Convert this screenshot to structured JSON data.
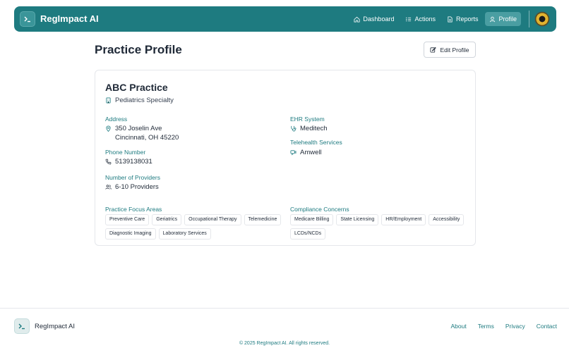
{
  "header": {
    "brand": "RegImpact AI",
    "nav": [
      {
        "label": "Dashboard",
        "icon": "home-icon"
      },
      {
        "label": "Actions",
        "icon": "list-icon"
      },
      {
        "label": "Reports",
        "icon": "file-icon"
      },
      {
        "label": "Profile",
        "icon": "user-icon",
        "active": true
      }
    ]
  },
  "page": {
    "title": "Practice Profile",
    "edit_label": "Edit Profile"
  },
  "practice": {
    "name": "ABC Practice",
    "specialty": "Pediatrics Specialty",
    "address_label": "Address",
    "address_line1": "350 Joselin Ave",
    "address_line2": "Cincinnati, OH 45220",
    "phone_label": "Phone Number",
    "phone": "5139138031",
    "providers_label": "Number of Providers",
    "providers": "6-10 Providers",
    "ehr_label": "EHR System",
    "ehr": "Meditech",
    "telehealth_label": "Telehealth Services",
    "telehealth": "Amwell",
    "focus_label": "Practice Focus Areas",
    "focus_areas": [
      "Preventive Care",
      "Geriatrics",
      "Occupational Therapy",
      "Telemedicine",
      "Diagnostic Imaging",
      "Laboratory Services"
    ],
    "compliance_label": "Compliance Concerns",
    "compliance_concerns": [
      "Medicare Billing",
      "State Licensing",
      "HR/Employment",
      "Accessibility",
      "LCDs/NCDs"
    ]
  },
  "footer": {
    "brand": "RegImpact AI",
    "links": [
      "About",
      "Terms",
      "Privacy",
      "Contact"
    ],
    "copyright": "© 2025 RegImpact AI. All rights reserved."
  },
  "colors": {
    "accent": "#1e7b80",
    "accent_active": "#4a9ea2"
  }
}
